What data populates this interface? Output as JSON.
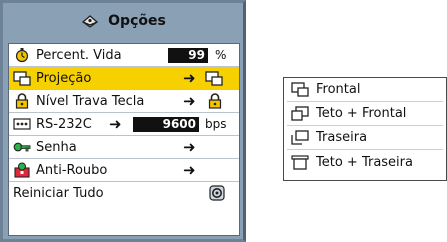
{
  "menu": {
    "title": "Opções",
    "items": [
      {
        "label": "Percent. Vida",
        "value": "99",
        "unit": "%"
      },
      {
        "label": "Projeção",
        "arrow": "➜"
      },
      {
        "label": "Nível Trava Tecla",
        "arrow": "➜"
      },
      {
        "label": "RS-232C",
        "arrow": "➜",
        "value": "9600",
        "unit": "bps"
      },
      {
        "label": "Senha",
        "arrow": "➜"
      },
      {
        "label": "Anti-Roubo",
        "arrow": "➜"
      },
      {
        "label": "Reiniciar Tudo"
      }
    ]
  },
  "submenu": {
    "items": [
      {
        "label": "Frontal"
      },
      {
        "label": "Teto + Frontal"
      },
      {
        "label": "Traseira"
      },
      {
        "label": "Teto + Traseira"
      }
    ]
  },
  "colors": {
    "menu_bg": "#8aa0b4",
    "selected_bg": "#f7d000",
    "value_box": "#111111"
  }
}
